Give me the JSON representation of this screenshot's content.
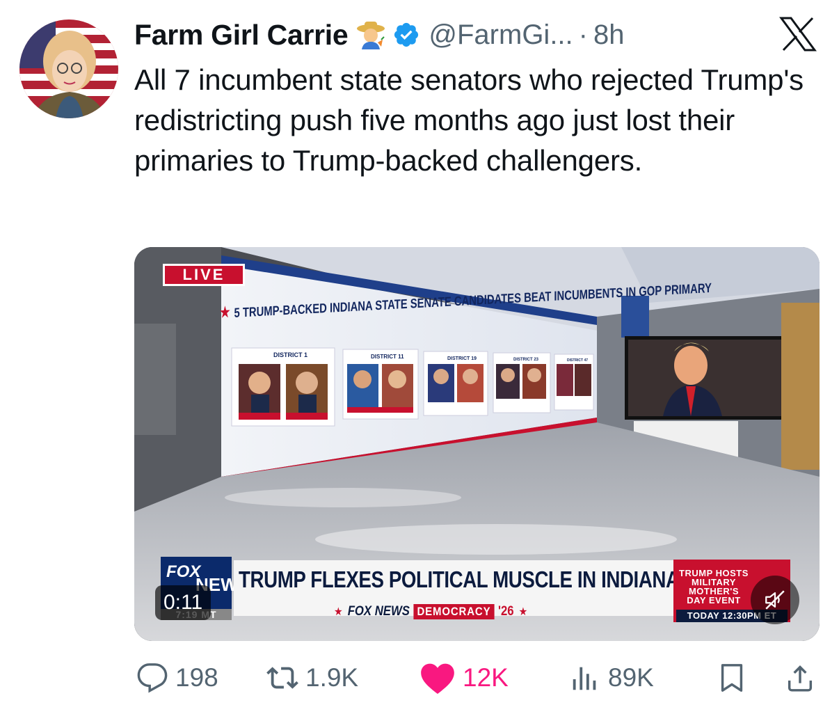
{
  "author": {
    "name": "Farm Girl Carrie",
    "handle": "@FarmGi...",
    "separator": "·",
    "time": "8h",
    "emoji_icon": "farmer-emoji-icon",
    "verified_icon": "verified-badge-icon"
  },
  "tweet": {
    "text": "All 7 incumbent state senators who rejected Trump's redistricting push five months ago just lost their primaries to Trump-backed challengers."
  },
  "media": {
    "live_label": "LIVE",
    "board_title": "5 TRUMP-BACKED INDIANA STATE SENATE CANDIDATES BEAT INCUMBENTS IN GOP PRIMARY",
    "board_districts": [
      "DISTRICT 1",
      "DISTRICT 11",
      "DISTRICT 19",
      "DISTRICT 23",
      "DISTRICT 47"
    ],
    "chyron": "TRUMP FLEXES POLITICAL MUSCLE IN INDIANA",
    "network": "FOX NEWS",
    "logo_top": "FOX",
    "logo_bottom": "NEWS",
    "democracy": "DEMOCRACY",
    "year": "'26",
    "clock": "7:19 MT",
    "promo_text": "TRUMP HOSTS MILITARY MOTHER'S DAY EVENT",
    "promo_time": "TODAY 12:30PM ET",
    "timer": "0:11",
    "mute_icon": "muted-speaker-icon"
  },
  "actions": {
    "replies": "198",
    "reposts": "1.9K",
    "likes": "12K",
    "views": "89K"
  },
  "colors": {
    "like_pink": "#f91880",
    "verified_blue": "#1d9bf0",
    "text_secondary": "#536471",
    "fox_red": "#c8102e",
    "fox_navy": "#0c1b3e"
  }
}
